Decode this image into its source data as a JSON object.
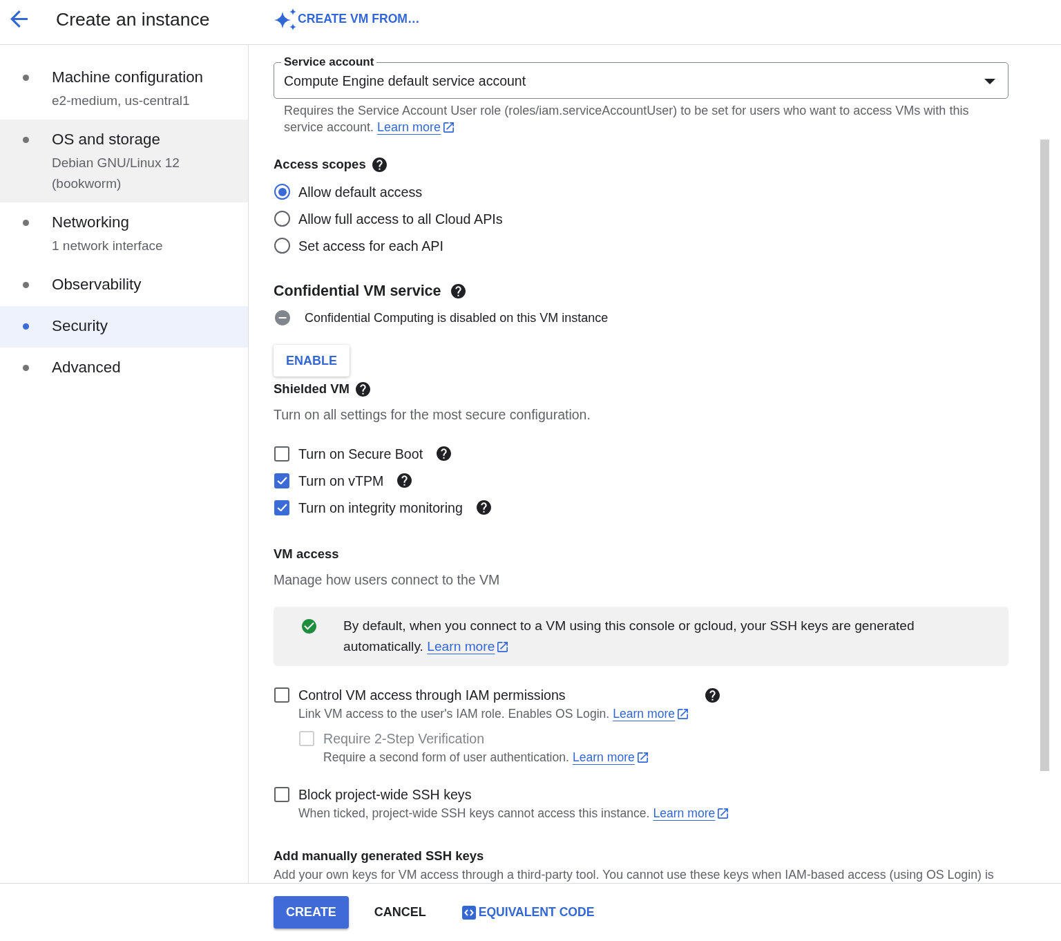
{
  "header": {
    "title": "Create an instance",
    "action": "CREATE VM FROM…"
  },
  "sidebar": {
    "items": [
      {
        "title": "Machine configuration",
        "subtitle": "e2-medium, us-central1",
        "selected": false,
        "hovered": false
      },
      {
        "title": "OS and storage",
        "subtitle": "Debian GNU/Linux 12 (bookworm)",
        "selected": false,
        "hovered": true
      },
      {
        "title": "Networking",
        "subtitle": "1 network interface",
        "selected": false,
        "hovered": false
      },
      {
        "title": "Observability",
        "selected": false,
        "hovered": false
      },
      {
        "title": "Security",
        "selected": true,
        "hovered": false
      },
      {
        "title": "Advanced",
        "selected": false,
        "hovered": false
      }
    ]
  },
  "service_account": {
    "label": "Service account",
    "value": "Compute Engine default service account",
    "help": "Requires the Service Account User role (roles/iam.serviceAccountUser) to be set for users who want to access VMs with this service account.",
    "link": "Learn more"
  },
  "access_scopes": {
    "title": "Access scopes",
    "options": [
      {
        "label": "Allow default access",
        "selected": true
      },
      {
        "label": "Allow full access to all Cloud APIs",
        "selected": false
      },
      {
        "label": "Set access for each API",
        "selected": false
      }
    ]
  },
  "confidential_vm": {
    "title": "Confidential VM service",
    "status": "Confidential Computing is disabled on this VM instance",
    "button": "ENABLE"
  },
  "shielded_vm": {
    "title": "Shielded VM",
    "description": "Turn on all settings for the most secure configuration.",
    "options": [
      {
        "label": "Turn on Secure Boot",
        "checked": false,
        "help": true
      },
      {
        "label": "Turn on vTPM",
        "checked": true,
        "help": true
      },
      {
        "label": "Turn on integrity monitoring",
        "checked": true,
        "help": true
      }
    ]
  },
  "vm_access": {
    "title": "VM access",
    "description": "Manage how users connect to the VM",
    "notice": {
      "text": "By default, when you connect to a VM using this console or gcloud, your SSH keys are generated automatically.",
      "link": "Learn more"
    },
    "options": [
      {
        "label": "Control VM access through IAM permissions",
        "description": "Link VM access to the user's IAM role. Enables OS Login.",
        "link": "Learn more",
        "checked": false,
        "disabled": false,
        "help": true,
        "children": [
          {
            "label": "Require 2-Step Verification",
            "description": "Require a second form of user authentication.",
            "link": "Learn more",
            "checked": false,
            "disabled": true,
            "help": false
          }
        ]
      },
      {
        "label": "Block project-wide SSH keys",
        "description": "When ticked, project-wide SSH keys cannot access this instance.",
        "link": "Learn more",
        "checked": false,
        "disabled": false,
        "help": false
      }
    ]
  },
  "ssh_keys": {
    "title": "Add manually generated SSH keys",
    "description": "Add your own keys for VM access through a third-party tool. You cannot use these keys when IAM-based access (using OS Login) is"
  },
  "footer": {
    "buttons": [
      {
        "label": "CREATE",
        "kind": "primary"
      },
      {
        "label": "CANCEL",
        "kind": "text"
      },
      {
        "label": "EQUIVALENT CODE",
        "kind": "code"
      }
    ]
  }
}
